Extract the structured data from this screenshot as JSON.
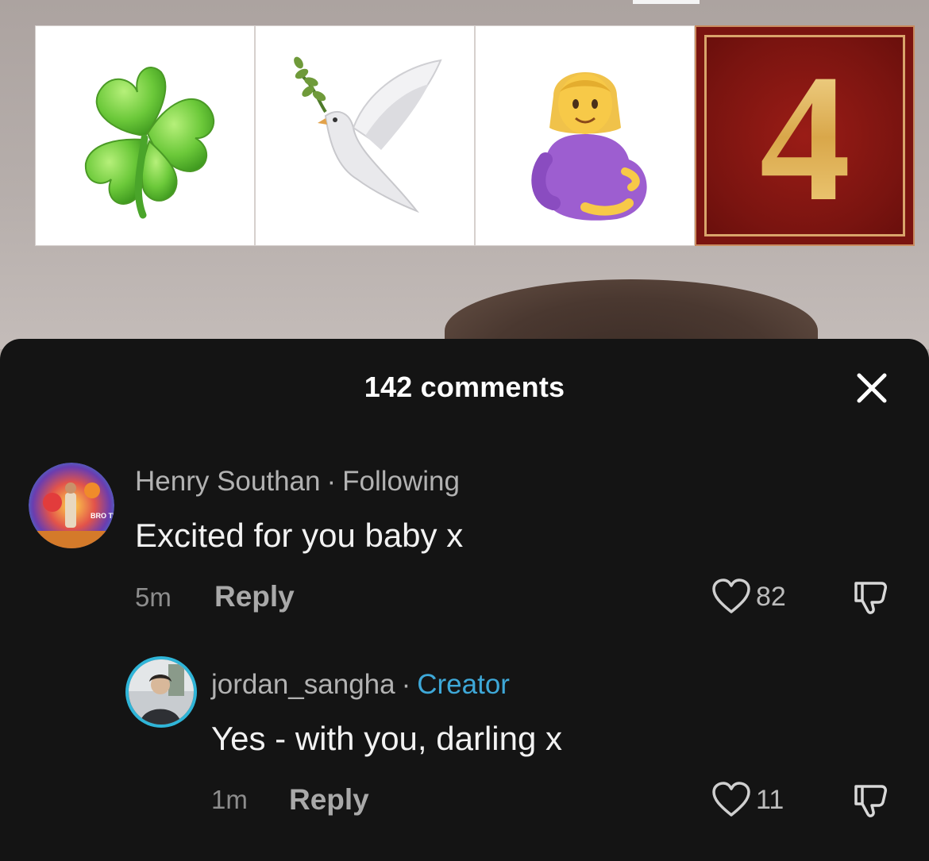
{
  "video": {
    "emoji_tiles": [
      {
        "icon": "four-leaf-clover-icon"
      },
      {
        "icon": "dove-icon"
      },
      {
        "icon": "pregnant-woman-icon"
      },
      {
        "icon": "keycap-four-icon",
        "digit": "4"
      }
    ]
  },
  "sheet": {
    "title": "142 comments",
    "close_icon": "close-icon"
  },
  "comments": [
    {
      "author": "Henry Southan",
      "separator": "·",
      "tag": "Following",
      "text": "Excited for you baby x",
      "time": "5m",
      "reply_label": "Reply",
      "likes": "82",
      "avatar_text": "BRO THE"
    },
    {
      "author": "jordan_sangha",
      "separator": "·",
      "tag": "Creator",
      "text": "Yes - with you, darling x",
      "time": "1m",
      "reply_label": "Reply",
      "likes": "11"
    }
  ],
  "colors": {
    "sheet_bg": "#141414",
    "creator_tag": "#3ea8d8",
    "avatar_ring": "#2fb5d8"
  }
}
